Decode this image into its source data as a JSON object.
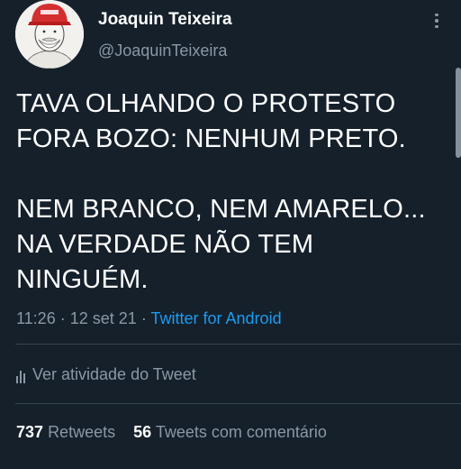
{
  "author": {
    "display_name": "Joaquin Teixeira",
    "handle": "@JoaquinTeixeira"
  },
  "tweet": {
    "paragraphs": [
      "TAVA OLHANDO O PROTESTO FORA BOZO: NENHUM PRETO.",
      "NEM BRANCO, NEM AMARELO... NA VERDADE NÃO TEM NINGUÉM."
    ],
    "time": "11:26",
    "separator": "·",
    "date": "12 set 21",
    "source": "Twitter for Android"
  },
  "activity": {
    "label": "Ver atividade do Tweet",
    "icon": "bar-chart-icon"
  },
  "stats": {
    "retweets_count": "737",
    "retweets_label": "Retweets",
    "quotes_count": "56",
    "quotes_label": "Tweets com comentário"
  },
  "colors": {
    "background": "#15202b",
    "text": "#ffffff",
    "secondary": "#8b98a5",
    "link": "#1d9bf0",
    "avatar_hat": "#d32f2f"
  }
}
